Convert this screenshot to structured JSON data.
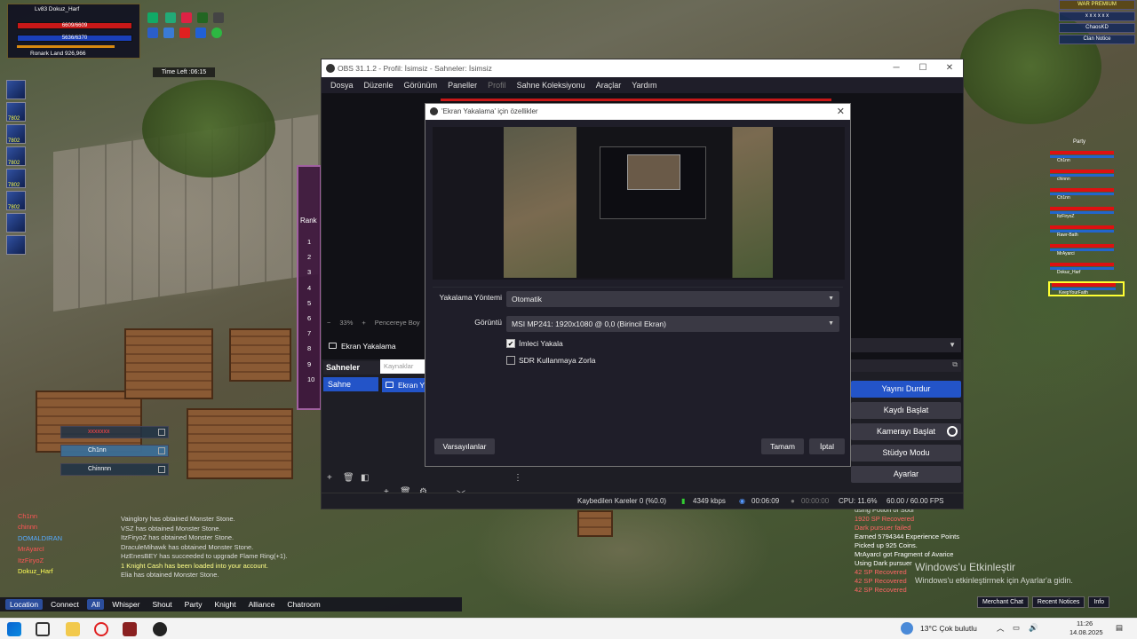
{
  "game": {
    "player": {
      "level_name": "Lv83 Dokuz_Harf",
      "hp": "6609/6609",
      "mp": "5636/6370",
      "location": "Ronark Land 926,966"
    },
    "timer": "Time Left :06:15",
    "skill_counts": [
      "7802",
      "7802",
      "7802",
      "7802",
      "7802"
    ],
    "rank_label": "Rank",
    "rank_numbers": [
      "1",
      "2",
      "3",
      "4",
      "5",
      "6",
      "7",
      "8",
      "9",
      "10"
    ],
    "party_left": [
      "xxxxxxx",
      "Ch1nn",
      "Chinnnn"
    ],
    "right_panel": [
      "WAR PREMIUM",
      "x x x x x x",
      "ChaosKD",
      "Clan Notice"
    ],
    "party_right": [
      "Ch1nn",
      "chinnn",
      "Ch1nn",
      "ItzFiryoZ",
      "Rawr-Bath",
      "MrAyarci",
      "Dokuz_Harf",
      "KeepYourFaith"
    ],
    "party_right_label": "Party",
    "chat_names": [
      "Ch1nn",
      "chinnn",
      "DOMALDIRAN",
      "MrAyarcI",
      "ItzFiryoZ",
      "Dokuz_Harf"
    ],
    "chat_lines": [
      "Vainglory has obtained Monster Stone.",
      "VSZ has obtained Monster Stone.",
      "ItzFiryoZ has obtained Monster Stone.",
      "DraculeMihawk has obtained Monster Stone.",
      "HzEnesBEY has succeeded to upgrade Flame Ring(+1).",
      "1 Knight Cash has been loaded into your account.",
      "Elia has obtained Monster Stone."
    ],
    "sys_log": [
      "using Potion of Soul",
      "1920 SP Recovered",
      "Dark pursuer failed",
      "Earned 5794344 Experience Points",
      "Picked up 925 Coins.",
      "MrAyarcI got Fragment of Avarice",
      "Using Dark pursuer",
      "42 SP Recovered",
      "42 SP Recovered",
      "42 SP Recovered"
    ],
    "bottom_tabs": [
      "Location",
      "Connect",
      "All",
      "Whisper",
      "Shout",
      "Party",
      "Knight",
      "Alliance",
      "Chatroom"
    ],
    "bottom_active_tab": "All",
    "bottom_right_tabs": [
      "Merchant Chat",
      "Recent Notices",
      "Info"
    ],
    "activation": {
      "title": "Windows'u Etkinleştir",
      "subtitle": "Windows'u etkinleştirmek için Ayarlar'a gidin."
    }
  },
  "obs": {
    "title": "OBS 31.1.2 - Profil: İsimsiz - Sahneler: İsimsiz",
    "menu": [
      "Dosya",
      "Düzenle",
      "Görünüm",
      "Paneller",
      "Profil",
      "Sahne Koleksiyonu",
      "Araçlar",
      "Yardım"
    ],
    "menu_disabled": "Profil",
    "zoom": "33%",
    "fit_label": "Pencereye Boy",
    "source_label": "Ekran Yakalama",
    "scenes_header": "Sahneler",
    "scene_item": "Sahne",
    "sources_tab": "Kaynaklar",
    "source_item": "Ekran Y",
    "controls": [
      "Yayını Durdur",
      "Kaydı Başlat",
      "Kamerayı Başlat",
      "Stüdyo Modu",
      "Ayarlar"
    ],
    "status": {
      "dropped": "Kaybedilen Kareler 0 (%0.0)",
      "bitrate": "4349 kbps",
      "stream_time": "00:06:09",
      "rec_time": "00:00:00",
      "cpu": "CPU: 11.6%",
      "fps": "60.00 / 60.00 FPS"
    }
  },
  "dialog": {
    "title": "'Ekran Yakalama' için özellikler",
    "capture_method_label": "Yakalama Yöntemi",
    "capture_method_value": "Otomatik",
    "display_label": "Görüntü",
    "display_value": "MSI MP241: 1920x1080 @ 0,0 (Birincil Ekran)",
    "capture_cursor_label": "İmleci Yakala",
    "capture_cursor_checked": true,
    "force_sdr_label": "SDR Kullanmaya Zorla",
    "force_sdr_checked": false,
    "defaults_button": "Varsayılanlar",
    "ok_button": "Tamam",
    "cancel_button": "İptal"
  },
  "taskbar": {
    "weather": "13°C Çok bulutlu",
    "time": "11:26",
    "date": "14.08.2025"
  },
  "colors": {
    "accent": "#2354c8",
    "obs_bg": "#1f1e29",
    "obs_button": "#3a3944"
  }
}
